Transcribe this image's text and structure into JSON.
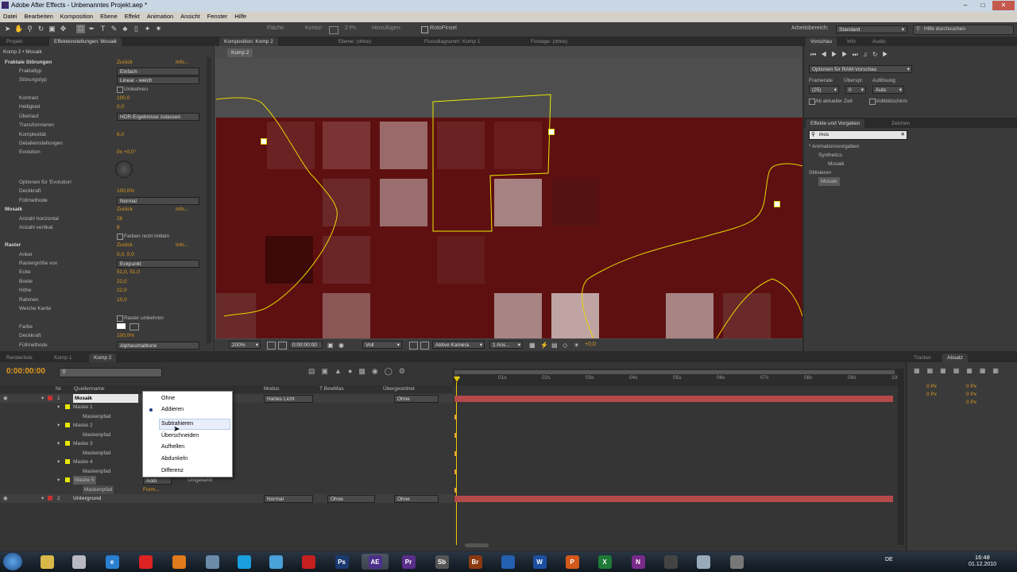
{
  "window": {
    "title": "Adobe After Effects - Unbenanntes Projekt.aep *"
  },
  "menu": [
    "Datei",
    "Bearbeiten",
    "Komposition",
    "Ebene",
    "Effekt",
    "Animation",
    "Ansicht",
    "Fenster",
    "Hilfe"
  ],
  "toolbar": {
    "fill_label": "Fläche:",
    "stroke_label": "Kontur:",
    "stroke_width": "2 Px",
    "add_label": "Hinzufügen:",
    "roto_label": "RotoPinsel",
    "workspace_label": "Arbeitsbereich:",
    "workspace_value": "Standard",
    "help_placeholder": "Hilfe durchsuchen"
  },
  "left_panel": {
    "tabs": [
      "Projekt",
      "Effekteinstellungen: Mosaik"
    ],
    "header": "Komp 2 • Mosaik",
    "rows": [
      {
        "label": "Fraktale Störungen",
        "value": "Zurück",
        "extra": "Info...",
        "fx": true
      },
      {
        "label": "Fraktaltyp",
        "value": "Einfach",
        "dropdown": true
      },
      {
        "label": "Störungstyp",
        "value": "Linear - weich",
        "dropdown": true
      },
      {
        "label": "",
        "value": "Umkehren",
        "checkbox": true
      },
      {
        "label": "Kontrast",
        "value": "100,0"
      },
      {
        "label": "Helligkeit",
        "value": "0,0"
      },
      {
        "label": "Überlauf",
        "value": "HDR-Ergebnisse zulassen",
        "dropdown": true
      },
      {
        "label": "Transformieren",
        "value": ""
      },
      {
        "label": "Komplexität",
        "value": "6,0"
      },
      {
        "label": "Detaileinstellungen",
        "value": ""
      },
      {
        "label": "Evolution",
        "value": "0x +0,0°"
      },
      {
        "label": "Optionen für 'Evolution'",
        "value": ""
      },
      {
        "label": "Deckkraft",
        "value": "100,0%"
      },
      {
        "label": "Füllmethode",
        "value": "Normal",
        "dropdown": true
      },
      {
        "label": "Mosaik",
        "value": "Zurück",
        "extra": "Info...",
        "fx": true
      },
      {
        "label": "Anzahl horizontal",
        "value": "26"
      },
      {
        "label": "Anzahl vertikal",
        "value": "8"
      },
      {
        "label": "",
        "value": "Farben nicht mitteln",
        "checkbox": true
      },
      {
        "label": "Raster",
        "value": "Zurück",
        "extra": "Info...",
        "fx": true
      },
      {
        "label": "Anker",
        "value": "0,0, 0,0"
      },
      {
        "label": "Rastergröße von",
        "value": "Eckpunkt",
        "dropdown": true
      },
      {
        "label": "Ecke",
        "value": "51,0, 51,0"
      },
      {
        "label": "Breite",
        "value": "22,0"
      },
      {
        "label": "Höhe",
        "value": "22,0"
      },
      {
        "label": "Rahmen",
        "value": "10,0"
      },
      {
        "label": "Weiche Kante",
        "value": ""
      },
      {
        "label": "",
        "value": "Raster umkehren",
        "checkbox": true
      },
      {
        "label": "Farbe",
        "value": ""
      },
      {
        "label": "Deckkraft",
        "value": "100,0%"
      },
      {
        "label": "Füllmethode",
        "value": "Alphaschablone",
        "dropdown": true
      }
    ]
  },
  "comp_panel": {
    "tabs": [
      "Komposition: Komp 2",
      "Ebene: (ohne)",
      "Flussdiagramm: Komp 1",
      "Footage: (ohne)"
    ],
    "breadcrumb": "Komp 2",
    "zoom": "200%",
    "timecode": "0:00:00:00",
    "resolution": "Voll",
    "camera": "Aktive Kamera",
    "views": "1 Ans...",
    "exposure": "+0,0"
  },
  "preview_panel": {
    "tabs": [
      "Vorschau",
      "Info",
      "Audio"
    ],
    "ram_options": "Optionen für RAM-Vorschau",
    "framerate_label": "Framerate",
    "skip_label": "Überspr.",
    "resolution_label": "Auflösung",
    "framerate_value": "(25)",
    "skip_value": "0",
    "resolution_value": "Auto",
    "from_current": "Ab aktueller Zeit",
    "fullscreen": "Vollbildschirm"
  },
  "effects_panel": {
    "tabs": [
      "Effekte und Vorgaben",
      "Zeichen"
    ],
    "search_value": "mos",
    "tree": [
      {
        "label": "* Animationsvorgaben",
        "level": 0
      },
      {
        "label": "Synthetics",
        "level": 1
      },
      {
        "label": "Mosaik",
        "level": 2
      },
      {
        "label": "Stilisieren",
        "level": 0
      },
      {
        "label": "Mosaik",
        "level": 1
      }
    ]
  },
  "timeline": {
    "tabs": [
      "Renderliste",
      "Komp 1",
      "Komp 2"
    ],
    "timecode": "0:00:00:00",
    "col_headers": {
      "nr": "Nr.",
      "source": "Quellenname",
      "mode": "Modus",
      "trkmat": "T  BewMas",
      "parent": "Übergeordnet"
    },
    "ruler": [
      "0s",
      "01s",
      "02s",
      "03s",
      "04s",
      "05s",
      "06s",
      "07s",
      "08s",
      "09s",
      "10s"
    ],
    "layers": [
      {
        "nr": "1",
        "name": "Mosaik",
        "mode": "Hartes Licht",
        "parent": "Ohne",
        "color": "#c43232"
      },
      {
        "nr": "",
        "name": "Maske 1",
        "color": "#e8e800"
      },
      {
        "nr": "",
        "name": "Maskenpfad"
      },
      {
        "nr": "",
        "name": "Maske 2",
        "color": "#e8e800"
      },
      {
        "nr": "",
        "name": "Maskenpfad"
      },
      {
        "nr": "",
        "name": "Maske 3",
        "color": "#e8e800"
      },
      {
        "nr": "",
        "name": "Maskenpfad"
      },
      {
        "nr": "",
        "name": "Maske 4",
        "color": "#e8e800"
      },
      {
        "nr": "",
        "name": "Maskenpfad"
      },
      {
        "nr": "",
        "name": "Maske 5",
        "color": "#e8e800",
        "mode": "Addi",
        "extra": "Umgekehrt"
      },
      {
        "nr": "",
        "name": "Maskenpfad",
        "extra": "Form..."
      },
      {
        "nr": "2",
        "name": "Untergrund",
        "mode": "Normal",
        "trkmat": "Ohne",
        "parent": "Ohne",
        "color": "#c43232"
      }
    ],
    "context_menu": [
      "Ohne",
      "Addieren",
      "Subtrahieren",
      "Überschneiden",
      "Aufhellen",
      "Abdunkeln",
      "Differenz"
    ],
    "context_selected": "Addieren",
    "context_hover": "Subtrahieren"
  },
  "tracker_panel": {
    "tabs": [
      "Tracker",
      "Absatz"
    ],
    "values": [
      "0 Px",
      "0 Px",
      "0 Px",
      "0 Px",
      "0 Px"
    ]
  },
  "taskbar": {
    "apps": [
      "e",
      "Ps",
      "AE",
      "Pr",
      "Sb",
      "Br",
      "W",
      "P",
      "X",
      "N"
    ],
    "lang": "DE",
    "time": "16:48",
    "date": "01.12.2010"
  },
  "colors": {
    "accent_orange": "#e09a1f",
    "mask_yellow": "#e8e800",
    "comp_bg": "#5d0f0f",
    "layer_red": "#c43232"
  }
}
